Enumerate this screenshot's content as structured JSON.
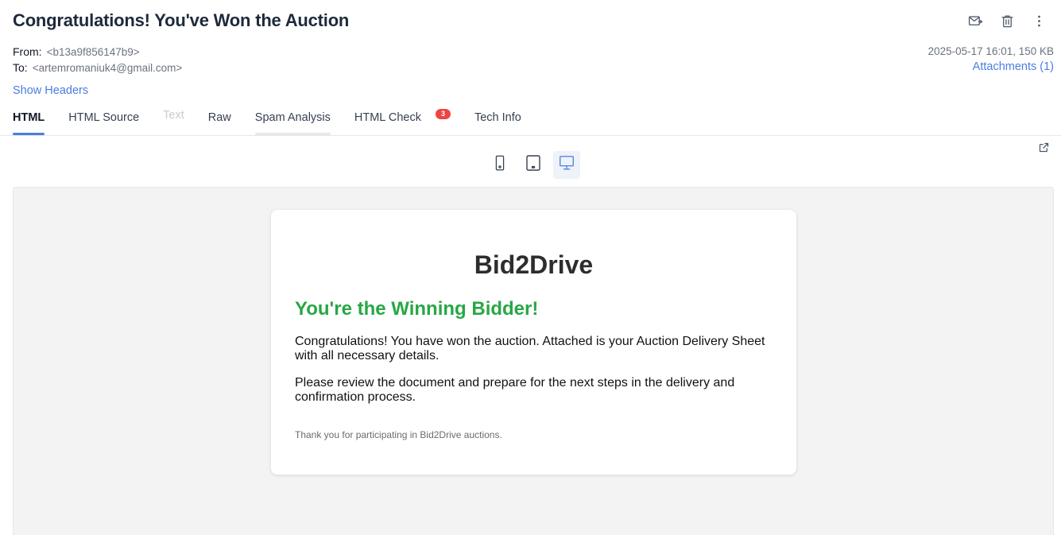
{
  "email": {
    "subject": "Congratulations! You've Won the Auction",
    "from_label": "From:",
    "from_address": "<b13a9f856147b9>",
    "to_label": "To:",
    "to_address": "<artemromaniuk4@gmail.com>",
    "date_size": "2025-05-17 16:01, 150 KB",
    "attachments": "Attachments (1)",
    "show_headers": "Show Headers"
  },
  "tabs": [
    {
      "label": "HTML",
      "state": "active"
    },
    {
      "label": "HTML Source",
      "state": "normal"
    },
    {
      "label": "Text",
      "state": "disabled"
    },
    {
      "label": "Raw",
      "state": "normal"
    },
    {
      "label": "Spam Analysis",
      "state": "hover"
    },
    {
      "label": "HTML Check",
      "state": "normal",
      "badge": "3"
    },
    {
      "label": "Tech Info",
      "state": "normal"
    }
  ],
  "icons": {
    "forward": "forward-mail-icon",
    "delete": "trash-icon",
    "more": "more-vertical-icon",
    "external": "external-link-icon",
    "mobile": "mobile-icon",
    "tablet": "tablet-icon",
    "desktop": "desktop-icon"
  },
  "device_view": {
    "selected": "desktop"
  },
  "preview": {
    "brand": "Bid2Drive",
    "headline": "You're the Winning Bidder!",
    "paragraph1": "Congratulations! You have won the auction. Attached is your Auction Delivery Sheet with all necessary details.",
    "paragraph2": "Please review the document and prepare for the next steps in the delivery and confirmation process.",
    "thanks": "Thank you for participating in Bid2Drive auctions."
  },
  "colors": {
    "accent": "#4a7ee0",
    "headline_green": "#28a745",
    "badge_red": "#ef4444"
  }
}
